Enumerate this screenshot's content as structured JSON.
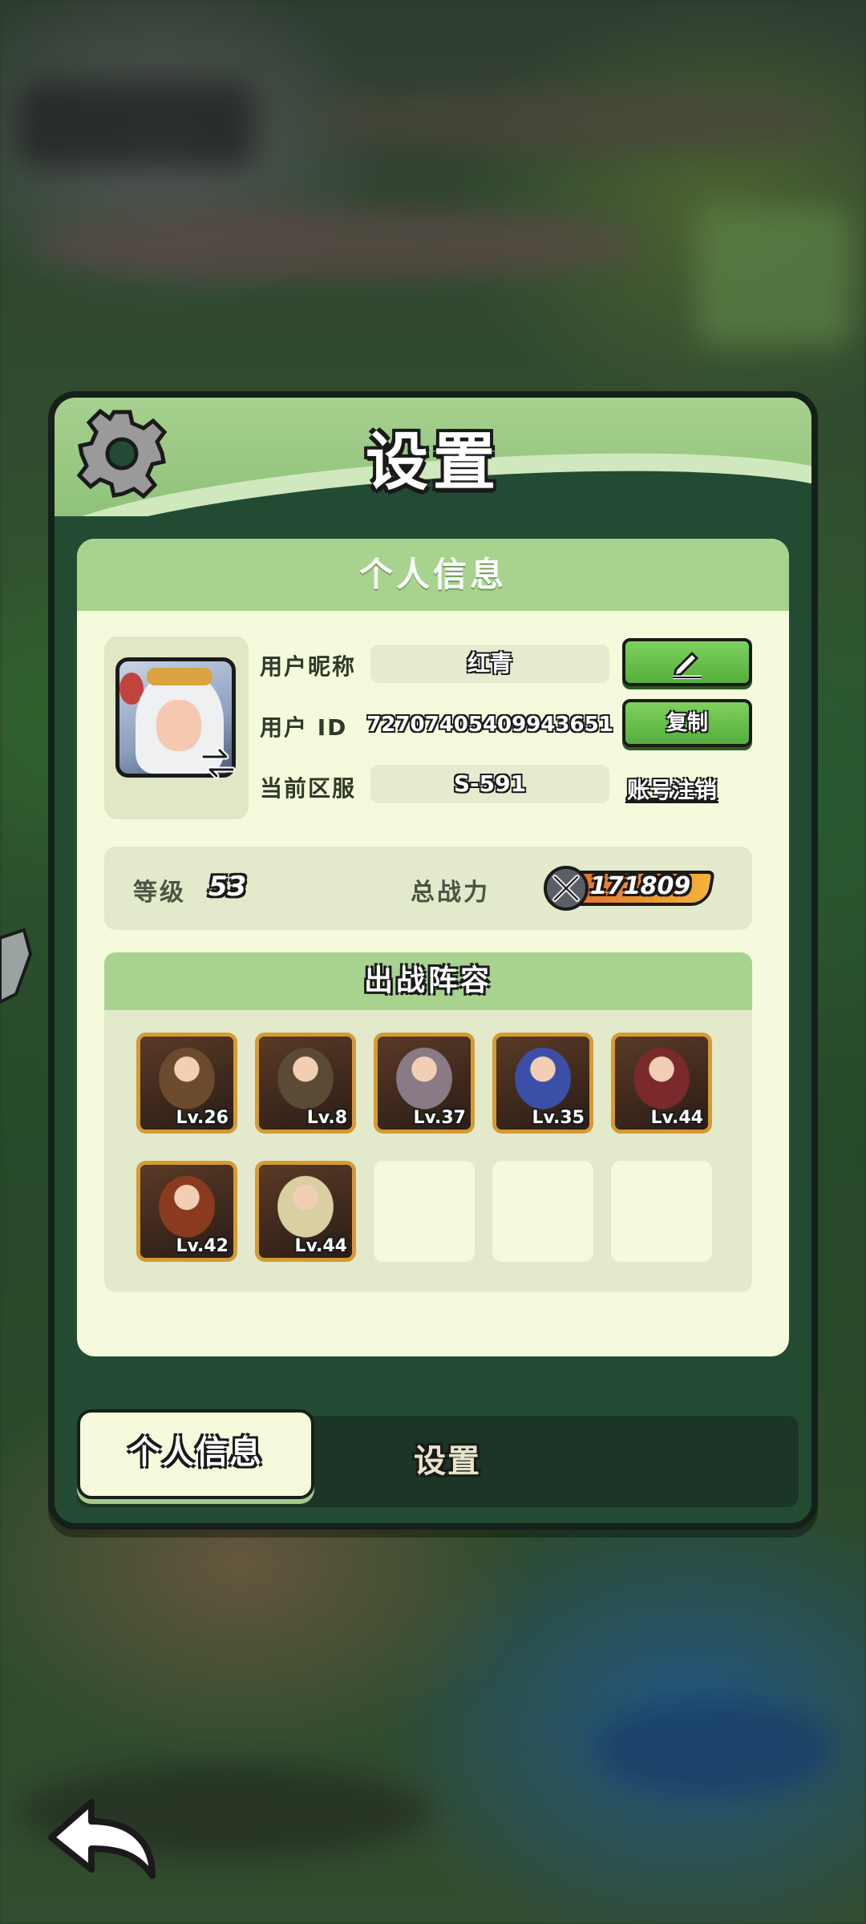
{
  "dialog": {
    "title": "设置"
  },
  "profile": {
    "section_title": "个人信息",
    "nickname_label": "用户昵称",
    "nickname_value": "红青",
    "id_label": "用户  ID",
    "id_value": "72707405409943651",
    "server_label": "当前区服",
    "server_value": "S-591",
    "copy_button_label": "复制",
    "deregister_link": "账号注销",
    "level_label": "等级",
    "level_value": "53",
    "power_label": "总战力",
    "power_value": "171809"
  },
  "lineup": {
    "title": "出战阵容",
    "heroes": [
      {
        "level": "Lv.26",
        "palette": "#6b4a2e"
      },
      {
        "level": "Lv.8",
        "palette": "#5a4a36"
      },
      {
        "level": "Lv.37",
        "palette": "#8a7a86"
      },
      {
        "level": "Lv.35",
        "palette": "#3c4fa8"
      },
      {
        "level": "Lv.44",
        "palette": "#7a2a2a"
      },
      {
        "level": "Lv.42",
        "palette": "#8a3a1e"
      },
      {
        "level": "Lv.44",
        "palette": "#d8cfa2"
      }
    ],
    "empty_slots": 3
  },
  "tabs": {
    "active_label": "个人信息",
    "inactive_label": "设置"
  },
  "colors": {
    "panel_bg": "#234b33",
    "card_bg": "#f6fadc",
    "header_green": "#a7d38f",
    "button_green": "#55ae3c",
    "frame_gold": "#d69a35"
  },
  "icons": {
    "settings": "gear-icon",
    "edit": "pencil-icon",
    "swap": "swap-arrows-icon",
    "power": "crossed-swords-icon",
    "back": "back-arrow-icon"
  }
}
